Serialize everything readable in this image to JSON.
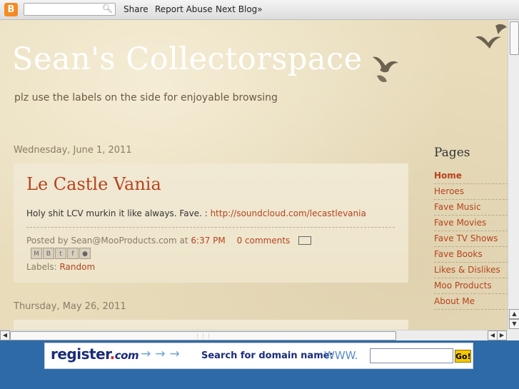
{
  "navbar": {
    "logo_glyph": "B",
    "search_placeholder": "",
    "share": "Share",
    "report_abuse": "Report Abuse",
    "next_blog": "Next Blog»"
  },
  "blog": {
    "title": "Sean's Collectorspace",
    "description": "plz use the labels on the side for enjoyable browsing"
  },
  "posts": [
    {
      "date": "Wednesday, June 1, 2011",
      "title": "Le Castle Vania",
      "body_text": "Holy shit LCV murkin it like always. Fave. : ",
      "body_link": "http://soundcloud.com/lecastlevania",
      "posted_by": "Posted by Sean@MooProducts.com at ",
      "time": "6:37 PM",
      "comments": "0 comments",
      "labels_prefix": "Labels: ",
      "label": "Random"
    },
    {
      "date": "Thursday, May 26, 2011"
    }
  ],
  "sidebar": {
    "title": "Pages",
    "items": [
      {
        "label": "Home"
      },
      {
        "label": "Heroes"
      },
      {
        "label": "Fave Music"
      },
      {
        "label": "Fave Movies"
      },
      {
        "label": "Fave TV Shows"
      },
      {
        "label": "Fave Books"
      },
      {
        "label": "Likes & Dislikes"
      },
      {
        "label": "Moo Products"
      },
      {
        "label": "About Me"
      }
    ]
  },
  "banner": {
    "brand_main": "register",
    "brand_dot": ".",
    "brand_com": "com",
    "prompt": "Search for domain name:",
    "www": "WWW.",
    "go": "Go!"
  },
  "colors": {
    "accent": "#b5431d",
    "page_bg": "#e8dcbb",
    "banner_bg": "#2f6aa8"
  }
}
